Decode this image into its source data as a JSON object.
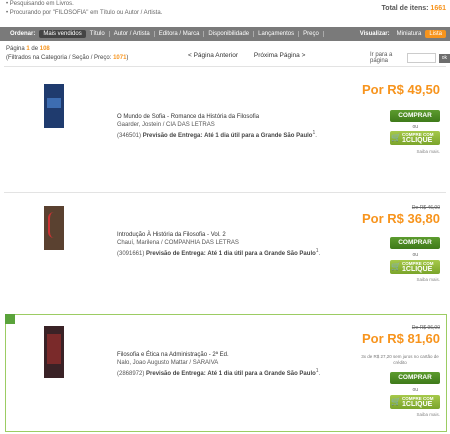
{
  "criteria": {
    "line1": "Pesquisando em Livros.",
    "line2": "Procurando por \"FILOSOFIA\" em Título ou Autor / Artista."
  },
  "total": {
    "label": "Total de itens:",
    "value": "1661"
  },
  "toolbar": {
    "order_label": "Ordenar:",
    "tabs": [
      "Mais vendidos",
      "Título",
      "Autor / Artista",
      "Editora / Marca",
      "Disponibilidade",
      "Lançamentos",
      "Preço"
    ],
    "view_label": "Visualizar:",
    "view_options": [
      "Miniatura",
      "Lista"
    ]
  },
  "pagination": {
    "page_word": "Página",
    "page_num": "1",
    "of_word": "de",
    "page_total": "108",
    "filtered_prefix": "(Filtrados na Categoria / Seção / Preço:",
    "filtered_num": "1071",
    "filtered_suffix": ")",
    "prev": "< Página Anterior",
    "next": "Próxima Página >",
    "goto_label": "Ir para a página",
    "ok": "ok"
  },
  "products": [
    {
      "title": "O Mundo de Sofia - Romance da História da Filosofia",
      "author": "Gaarder, Jostein / CIA DAS LETRAS",
      "code": "(346501)",
      "delivery_label": "Previsão de Entrega:",
      "delivery": "Até 1 dia útil para a Grande São Paulo",
      "sup": "1",
      "old_price": "",
      "price": "Por R$ 49,50",
      "installments": "",
      "cover_color": "#1f3b6e"
    },
    {
      "title": "Introdução À História da Filosofia - Vol. 2",
      "author": "Chauí, Marilena / COMPANHIA DAS LETRAS",
      "code": "(3091661)",
      "delivery_label": "Previsão de Entrega:",
      "delivery": "Até 1 dia útil para a Grande São Paulo",
      "sup": "1",
      "old_price": "De R$ 46,00",
      "price": "Por R$ 36,80",
      "installments": "",
      "cover_color": "#5a4130"
    },
    {
      "title": "Filosofia e Ética na Administração - 2ª Ed.",
      "author": "Nalo, Joao Augusto Mattar / SARAIVA",
      "code": "(2868972)",
      "delivery_label": "Previsão de Entrega:",
      "delivery": "Até 1 dia útil para a Grande São Paulo",
      "sup": "1",
      "old_price": "De R$ 96,00",
      "price": "Por R$ 81,60",
      "installments": "3x de R$ 27,20 sem juros no cartão de crédito",
      "cover_color": "#3a2226"
    }
  ],
  "buttons": {
    "buy": "COMPRAR",
    "or": "ou",
    "oneclick_top": "COMPRE COM",
    "oneclick_big": "1CLIQUE",
    "more": "Saiba mais."
  },
  "colors": {
    "accent": "#f7941d",
    "buy": "#4a8a23",
    "oneclick": "#8cb536",
    "toolbar": "#7a7a7a"
  }
}
